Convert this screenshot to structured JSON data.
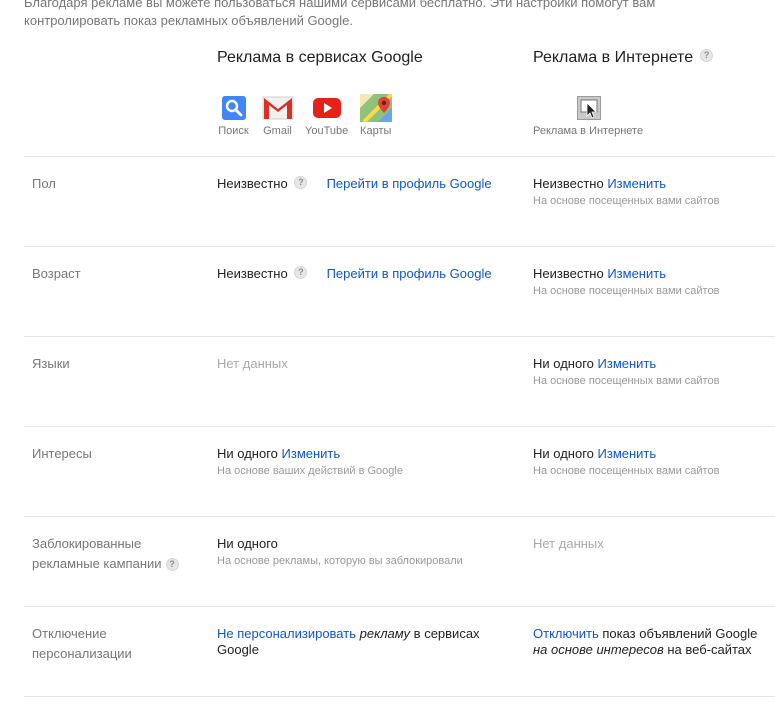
{
  "intro": {
    "line1": "Благодаря рекламе вы можете пользоваться нашими сервисами бесплатно. Эти настройки помогут вам",
    "line2": "контролировать показ рекламных объявлений Google."
  },
  "columns": {
    "google_title": "Реклама в сервисах Google",
    "web_title": "Реклама в Интернете",
    "help_glyph": "?"
  },
  "services": [
    {
      "label": "Поиск",
      "icon": "search-icon",
      "color": "#4285f4"
    },
    {
      "label": "Gmail",
      "icon": "gmail-icon",
      "color": "#d93025"
    },
    {
      "label": "YouTube",
      "icon": "youtube-icon",
      "color": "#e62117"
    },
    {
      "label": "Карты",
      "icon": "maps-icon",
      "color": "#34a853"
    }
  ],
  "web_icon": {
    "label": "Реклама в Интернете",
    "icon": "web-ads-icon"
  },
  "rows": {
    "gender": {
      "label": "Пол",
      "google": {
        "value": "Неизвестно",
        "link": "Перейти в профиль Google"
      },
      "web": {
        "value": "Неизвестно",
        "link": "Изменить",
        "note": "На основе посещенных вами сайтов"
      }
    },
    "age": {
      "label": "Возраст",
      "google": {
        "value": "Неизвестно",
        "link": "Перейти в профиль Google"
      },
      "web": {
        "value": "Неизвестно",
        "link": "Изменить",
        "note": "На основе посещенных вами сайтов"
      }
    },
    "languages": {
      "label": "Языки",
      "google": {
        "value": "Нет данных"
      },
      "web": {
        "value": "Ни одного",
        "link": "Изменить",
        "note": "На основе посещенных вами сайтов"
      }
    },
    "interests": {
      "label": "Интересы",
      "google": {
        "value": "Ни одного",
        "link": "Изменить",
        "note": "На основе ваших действий в Google"
      },
      "web": {
        "value": "Ни одного",
        "link": "Изменить",
        "note": "На основе посещенных вами сайтов"
      }
    },
    "blocked": {
      "label_line1": "Заблокированные",
      "label_line2": "рекламные кампании",
      "google": {
        "value": "Ни одного",
        "note": "На основе рекламы, которую вы заблокировали"
      },
      "web": {
        "value": "Нет данных"
      }
    },
    "optout": {
      "label_line1": "Отключение",
      "label_line2": "персонализации",
      "google": {
        "link": "Не персонализировать",
        "italic": "рекламу",
        "text": "в сервисах",
        "line2": "Google"
      },
      "web": {
        "link": "Отключить",
        "text": "показ объявлений Google",
        "italic": "на основе интересов",
        "text2": "на веб-сайтах"
      }
    }
  },
  "colors": {
    "link": "#1155cc",
    "muted": "#777777",
    "divider": "#e5e5e5"
  }
}
